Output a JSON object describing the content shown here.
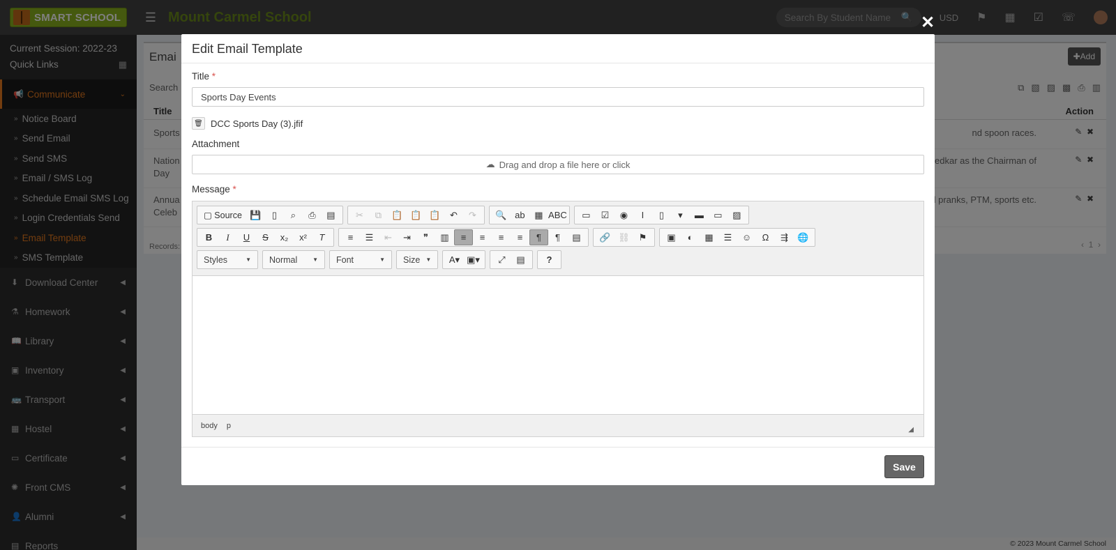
{
  "header": {
    "logo_text": "SMART SCHOOL",
    "school_name": "Mount Carmel School",
    "search_placeholder": "Search By Student Name",
    "currency": "USD"
  },
  "sidebar": {
    "session": "Current Session: 2022-23",
    "quick_links": "Quick Links",
    "active_menu": "Communicate",
    "sub_items": [
      "Notice Board",
      "Send Email",
      "Send SMS",
      "Email / SMS Log",
      "Schedule Email SMS Log",
      "Login Credentials Send",
      "Email Template",
      "SMS Template"
    ],
    "menus": [
      "Download Center",
      "Homework",
      "Library",
      "Inventory",
      "Transport",
      "Hostel",
      "Certificate",
      "Front CMS",
      "Alumni",
      "Reports"
    ]
  },
  "background": {
    "title": "Emai",
    "add_label": "Add",
    "search_label": "Search",
    "col_title": "Title",
    "col_action": "Action",
    "rows": [
      {
        "l1": "Sports",
        "l2": "",
        "r1": "nd spoon races."
      },
      {
        "l1": "Nation",
        "l2": "Day",
        "r1": "bedkar as the Chairman of"
      },
      {
        "l1": "Annua",
        "l2": "Celeb",
        "r1": ", all pranks, PTM, sports etc."
      }
    ],
    "records": "Records:",
    "page": "1",
    "footer": "© 2023 Mount Carmel School"
  },
  "modal": {
    "title": "Edit Email Template",
    "title_label": "Title",
    "title_value": "Sports Day Events",
    "file_name": "DCC Sports Day (3).jfif",
    "attachment_label": "Attachment",
    "dropzone_text": "Drag and drop a file here or click",
    "message_label": "Message",
    "toolbar": {
      "source": "Source",
      "styles": "Styles",
      "format": "Normal",
      "font": "Font",
      "size": "Size"
    },
    "path": [
      "body",
      "p"
    ],
    "save": "Save"
  }
}
